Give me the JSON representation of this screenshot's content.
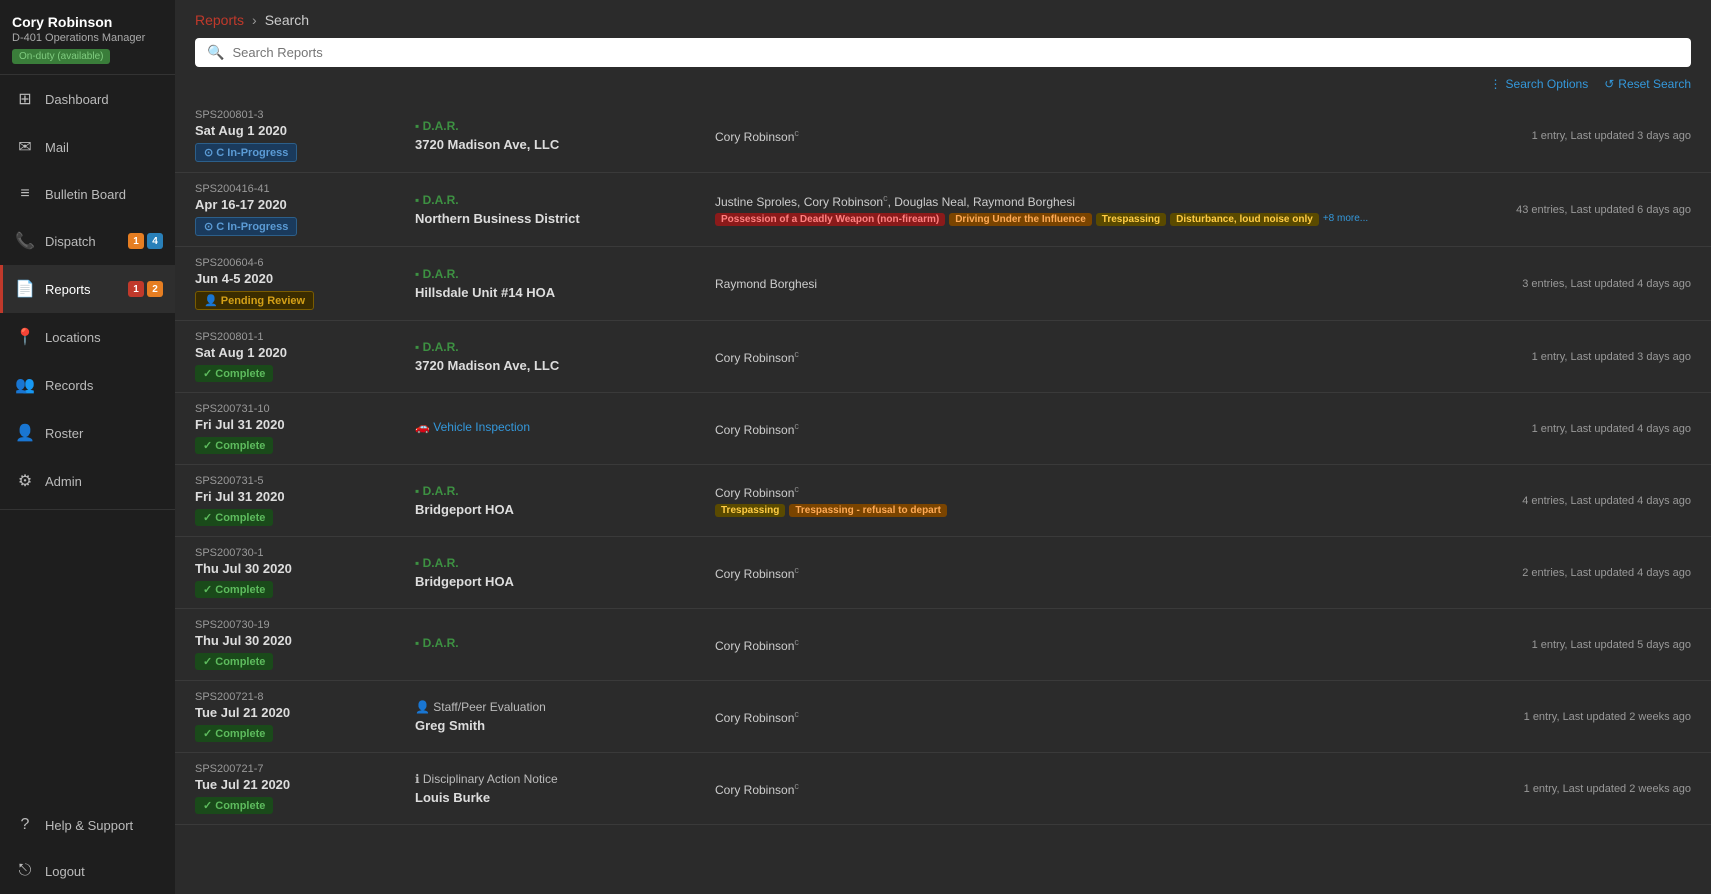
{
  "user": {
    "name": "Cory Robinson",
    "role": "D-401 Operations Manager",
    "status": "On-duty (available)"
  },
  "sidebar": {
    "items": [
      {
        "id": "dashboard",
        "label": "Dashboard",
        "icon": "⊞",
        "active": false,
        "badges": []
      },
      {
        "id": "mail",
        "label": "Mail",
        "icon": "✉",
        "active": false,
        "badges": []
      },
      {
        "id": "bulletin",
        "label": "Bulletin Board",
        "icon": "≡",
        "active": false,
        "badges": []
      },
      {
        "id": "dispatch",
        "label": "Dispatch",
        "icon": "📞",
        "active": false,
        "badges": [
          {
            "type": "orange",
            "val": "1"
          },
          {
            "type": "blue",
            "val": "4"
          }
        ]
      },
      {
        "id": "reports",
        "label": "Reports",
        "icon": "📄",
        "active": true,
        "badges": [
          {
            "type": "red",
            "val": "1"
          },
          {
            "type": "orange",
            "val": "2"
          }
        ]
      },
      {
        "id": "locations",
        "label": "Locations",
        "icon": "📍",
        "active": false,
        "badges": []
      },
      {
        "id": "records",
        "label": "Records",
        "icon": "👥",
        "active": false,
        "badges": []
      },
      {
        "id": "roster",
        "label": "Roster",
        "icon": "👤",
        "active": false,
        "badges": []
      },
      {
        "id": "admin",
        "label": "Admin",
        "icon": "⚙",
        "active": false,
        "badges": []
      }
    ],
    "bottom": [
      {
        "id": "help",
        "label": "Help & Support",
        "icon": "?"
      },
      {
        "id": "logout",
        "label": "Logout",
        "icon": "⎋"
      }
    ]
  },
  "breadcrumb": {
    "parent": "Reports",
    "current": "Search"
  },
  "search": {
    "placeholder": "Search Reports",
    "value": ""
  },
  "toolbar": {
    "search_options": "Search Options",
    "reset_search": "Reset Search"
  },
  "records": [
    {
      "id": "SPS200801-3",
      "date": "Sat Aug 1 2020",
      "status": "In-Progress",
      "status_type": "inprogress",
      "type_label": "D.A.R.",
      "type_color": "green",
      "location": "3720 Madison Ave, LLC",
      "officers": "Cory Robinson",
      "officer_sup": "c",
      "tags": [],
      "meta": "1 entry, Last updated 3 days ago"
    },
    {
      "id": "SPS200416-41",
      "date": "Apr 16-17 2020",
      "status": "In-Progress",
      "status_type": "inprogress",
      "type_label": "D.A.R.",
      "type_color": "green",
      "location": "Northern Business District",
      "officers": "Justine Sproles, Cory Robinson, Douglas Neal, Raymond Borghesi",
      "officer_sup": "c",
      "tags": [
        {
          "label": "Possession of a Deadly Weapon (non-firearm)",
          "color": "red"
        },
        {
          "label": "Driving Under the Influence",
          "color": "orange"
        },
        {
          "label": "Trespassing",
          "color": "yellow"
        },
        {
          "label": "Disturbance, loud noise only",
          "color": "yellow"
        }
      ],
      "more": "+8 more...",
      "meta": "43 entries, Last updated 6 days ago"
    },
    {
      "id": "SPS200604-6",
      "date": "Jun 4-5 2020",
      "status": "Pending Review",
      "status_type": "pending",
      "type_label": "D.A.R.",
      "type_color": "green",
      "location": "Hillsdale Unit #14 HOA",
      "officers": "Raymond Borghesi",
      "tags": [],
      "meta": "3 entries, Last updated 4 days ago"
    },
    {
      "id": "SPS200801-1",
      "date": "Sat Aug 1 2020",
      "status": "Complete",
      "status_type": "complete",
      "type_label": "D.A.R.",
      "type_color": "green",
      "location": "3720 Madison Ave, LLC",
      "officers": "Cory Robinson",
      "officer_sup": "c",
      "tags": [],
      "meta": "1 entry, Last updated 3 days ago"
    },
    {
      "id": "SPS200731-10",
      "date": "Fri Jul 31 2020",
      "status": "Complete",
      "status_type": "complete",
      "type_label": "Vehicle Inspection",
      "type_color": "blue",
      "location": "",
      "officers": "Cory Robinson",
      "officer_sup": "c",
      "tags": [],
      "meta": "1 entry, Last updated 4 days ago"
    },
    {
      "id": "SPS200731-5",
      "date": "Fri Jul 31 2020",
      "status": "Complete",
      "status_type": "complete",
      "type_label": "D.A.R.",
      "type_color": "green",
      "location": "Bridgeport HOA",
      "officers": "Cory Robinson",
      "officer_sup": "c",
      "tags": [
        {
          "label": "Trespassing",
          "color": "yellow"
        },
        {
          "label": "Trespassing - refusal to depart",
          "color": "orange"
        }
      ],
      "meta": "4 entries, Last updated 4 days ago"
    },
    {
      "id": "SPS200730-1",
      "date": "Thu Jul 30 2020",
      "status": "Complete",
      "status_type": "complete",
      "type_label": "D.A.R.",
      "type_color": "green",
      "location": "Bridgeport HOA",
      "officers": "Cory Robinson",
      "officer_sup": "c",
      "tags": [],
      "meta": "2 entries, Last updated 4 days ago"
    },
    {
      "id": "SPS200730-19",
      "date": "Thu Jul 30 2020",
      "status": "Complete",
      "status_type": "complete",
      "type_label": "D.A.R.",
      "type_color": "green",
      "location": "",
      "officers": "Cory Robinson",
      "officer_sup": "c",
      "tags": [],
      "meta": "1 entry, Last updated 5 days ago"
    },
    {
      "id": "SPS200721-8",
      "date": "Tue Jul 21 2020",
      "status": "Complete",
      "status_type": "complete",
      "type_label": "Staff/Peer Evaluation",
      "type_color": "gray",
      "location": "Greg Smith",
      "officers": "Cory Robinson",
      "officer_sup": "c",
      "tags": [],
      "meta": "1 entry, Last updated 2 weeks ago"
    },
    {
      "id": "SPS200721-7",
      "date": "Tue Jul 21 2020",
      "status": "Complete",
      "status_type": "complete",
      "type_label": "Disciplinary Action Notice",
      "type_color": "gray",
      "location": "Louis Burke",
      "officers": "Cory Robinson",
      "officer_sup": "c",
      "tags": [],
      "meta": "1 entry, Last updated 2 weeks ago"
    }
  ]
}
